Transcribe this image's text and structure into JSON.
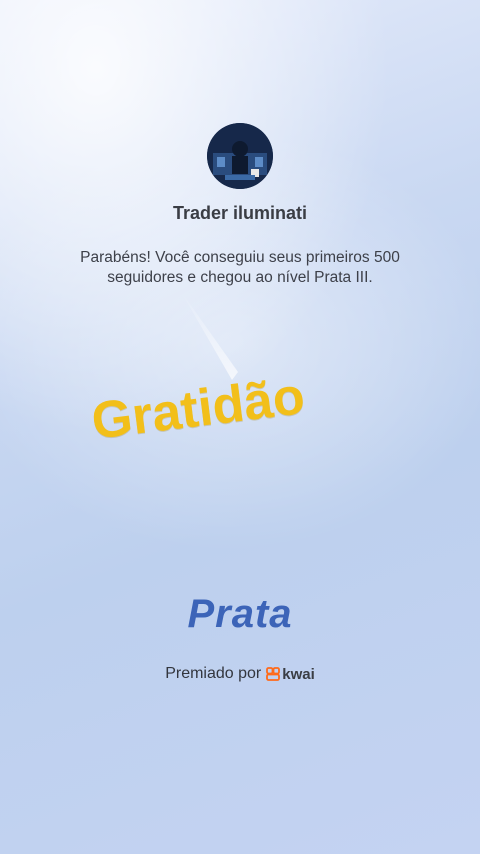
{
  "profile": {
    "username": "Trader iluminati",
    "avatar_icon": "avatar-image-icon"
  },
  "achievement": {
    "message": "Parabéns! Você conseguiu seus primeiros 500 seguidores e chegou ao nível Prata III.",
    "level_name": "Prata",
    "awarded_by_label": "Premiado por",
    "brand_name": "kwai",
    "brand_color": "#ff6a1a"
  },
  "overlay": {
    "text": "Gratidão",
    "color": "#f2bf1a"
  },
  "colors": {
    "level_text": "#3c64b8"
  }
}
